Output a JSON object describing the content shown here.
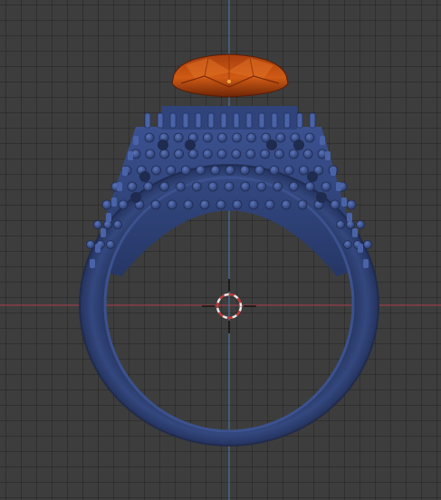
{
  "viewport": {
    "background_color": "#3d3d3d",
    "grid_line_color": "#2e2e2e",
    "x_axis_color": "#b0404a",
    "y_axis_color": "#4a79b5"
  },
  "model": {
    "object": "ring",
    "band_color": "#2b3b6a",
    "band_highlight_color": "#3e5596",
    "gem_color": "#c24f10",
    "gem_highlight_color": "#e57a2a",
    "origin_dot_color": "#f3a443"
  },
  "cursor_3d": {
    "icon": "3d-cursor-icon",
    "ring_colors": [
      "#e8e8e8",
      "#c03b3b"
    ]
  }
}
